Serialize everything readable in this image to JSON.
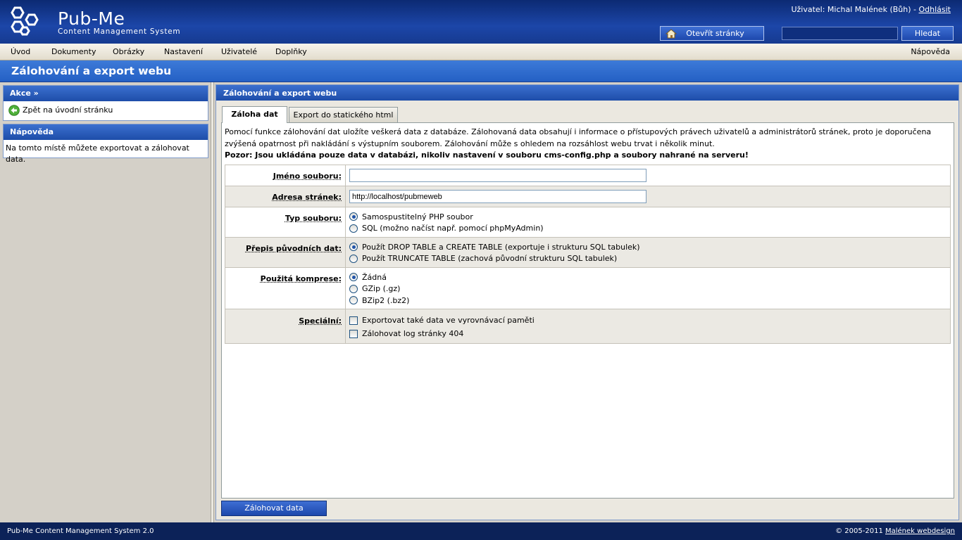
{
  "header": {
    "logo_title": "Pub-Me",
    "logo_subtitle": "Content Management System",
    "user_label": "Uživatel: Michal Malének (Bůh) -",
    "logout_link": "Odhlásit",
    "open_site_button": "Otevřít stránky",
    "search_value": "",
    "search_button": "Hledat"
  },
  "menu": {
    "items": [
      "Úvod",
      "Dokumenty",
      "Obrázky",
      "Nastavení",
      "Uživatelé",
      "Doplňky"
    ],
    "help": "Nápověda"
  },
  "page_title": "Zálohování a export webu",
  "sidebar": {
    "actions_title": "Akce »",
    "back_link": "Zpět na úvodní stránku",
    "help_title": "Nápověda",
    "help_text": "Na tomto místě můžete exportovat a zálohovat data."
  },
  "main": {
    "title": "Zálohování a export webu",
    "tabs": [
      "Záloha dat",
      "Export do statického html"
    ],
    "active_tab": "Záloha dat",
    "intro": "Pomocí funkce zálohování dat uložíte veškerá data z databáze. Zálohovaná data obsahují i informace o přístupových právech uživatelů a administrátorů stránek, proto je doporučena zvýšená opatrnost při nakládání s výstupním souborem. Zálohování může s ohledem na rozsáhlost webu trvat i několik minut.",
    "warning": "Pozor: Jsou ukládána pouze data v databázi, nikoliv nastavení v souboru cms-config.php a soubory nahrané na serveru!",
    "form": {
      "filename_label": "Jméno souboru:",
      "filename_value": "",
      "address_label": "Adresa stránek:",
      "address_value": "http://localhost/pubmeweb",
      "filetype_label": "Typ souboru:",
      "filetype_options": [
        "Samospustitelný PHP soubor",
        "SQL (možno načíst např. pomocí phpMyAdmin)"
      ],
      "filetype_selected": "Samospustitelný PHP soubor",
      "overwrite_label": "Přepis původních dat:",
      "overwrite_options": [
        "Použít DROP TABLE a CREATE TABLE (exportuje i strukturu SQL tabulek)",
        "Použít TRUNCATE TABLE (zachová původní strukturu SQL tabulek)"
      ],
      "overwrite_selected": "Použít DROP TABLE a CREATE TABLE (exportuje i strukturu SQL tabulek)",
      "compression_label": "Použitá komprese:",
      "compression_options": [
        "Žádná",
        "GZip (.gz)",
        "BZip2 (.bz2)"
      ],
      "compression_selected": "Žádná",
      "special_label": "Speciální:",
      "special_options": [
        "Exportovat také data ve vyrovnávací paměti",
        "Zálohovat log stránky 404"
      ],
      "special_checked": [
        false,
        false
      ]
    },
    "submit_button": "Zálohovat data"
  },
  "footer": {
    "left": "Pub-Me Content Management System 2.0",
    "copyright": "© 2005-2011",
    "link": "Malének webdesign"
  },
  "colors": {
    "header_blue": "#163a90",
    "accent_blue": "#2460c4",
    "footer_navy": "#0c2258"
  }
}
